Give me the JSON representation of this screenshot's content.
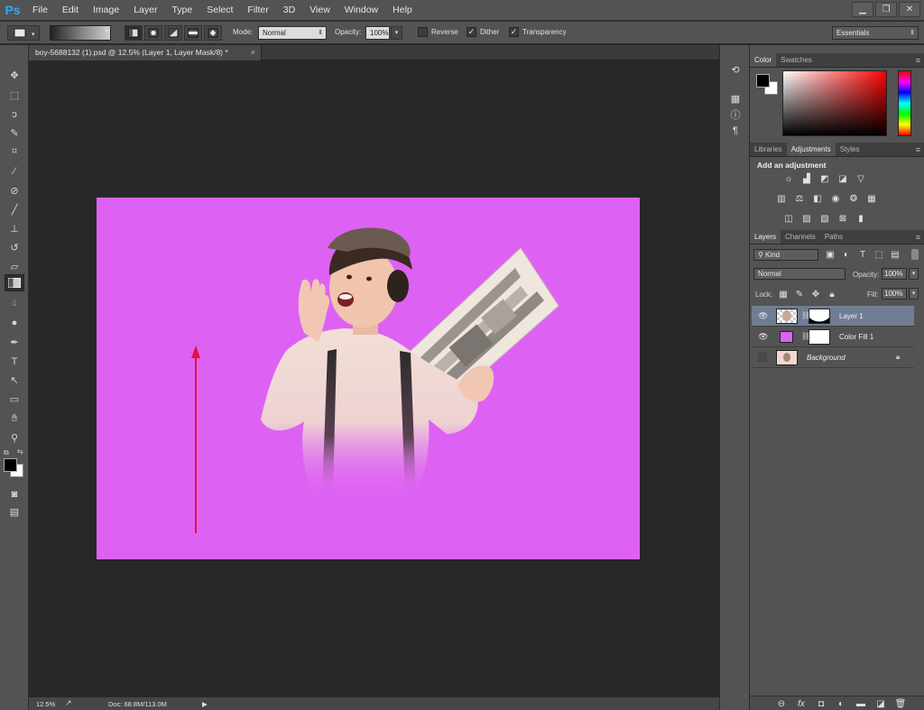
{
  "app": {
    "logo": "Ps"
  },
  "menu": [
    "File",
    "Edit",
    "Image",
    "Layer",
    "Type",
    "Select",
    "Filter",
    "3D",
    "View",
    "Window",
    "Help"
  ],
  "window_controls": {
    "minimize_icon": "minimize-icon",
    "restore_icon": "restore-icon",
    "close_icon": "close-icon"
  },
  "options": {
    "mode_label": "Mode:",
    "mode_value": "Normal",
    "opacity_label": "Opacity:",
    "opacity_value": "100%",
    "reverse_label": "Reverse",
    "reverse_checked": false,
    "dither_label": "Dither",
    "dither_checked": true,
    "transparency_label": "Transparency",
    "transparency_checked": true,
    "workspace": "Essentials"
  },
  "document": {
    "tab_title": "boy-5688132 (1).psd @ 12.5% (Layer 1, Layer Mask/8) *",
    "close_glyph": "×",
    "canvas_color": "#dd62f3"
  },
  "status": {
    "zoom": "12.5%",
    "doc_info": "Doc: 68.8M/113.0M",
    "arrow": "▶"
  },
  "panels": {
    "color_tabs": [
      "Color",
      "Swatches"
    ],
    "adjust_tabs": [
      "Libraries",
      "Adjustments",
      "Styles"
    ],
    "adjust_heading": "Add an adjustment",
    "layers_tabs": [
      "Layers",
      "Channels",
      "Paths"
    ],
    "filter_kind": "Kind",
    "blend_mode": "Normal",
    "opacity_label": "Opacity:",
    "opacity_value": "100%",
    "lock_label": "Lock:",
    "fill_label": "Fill:",
    "fill_value": "100%",
    "layers": [
      {
        "name": "Layer 1",
        "visible": true,
        "selected": true
      },
      {
        "name": "Color Fill 1",
        "visible": true,
        "selected": false
      },
      {
        "name": "Background",
        "visible": false,
        "selected": false,
        "locked": true
      }
    ]
  },
  "colors": {
    "accent": "#31a8ff",
    "canvas_fill": "#dd62f3",
    "arrow": "#e8103a",
    "selected_layer": "#6f7d93"
  }
}
